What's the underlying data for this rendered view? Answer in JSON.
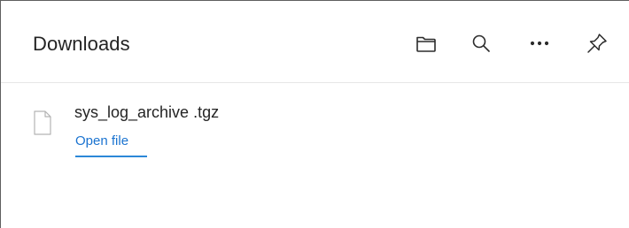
{
  "header": {
    "title": "Downloads",
    "tools": [
      {
        "name": "open-downloads-folder",
        "icon": "folder-icon"
      },
      {
        "name": "search-downloads",
        "icon": "search-icon"
      },
      {
        "name": "more-options",
        "icon": "more-horizontal-icon"
      },
      {
        "name": "pin-downloads",
        "icon": "pin-icon"
      }
    ]
  },
  "downloads": {
    "items": [
      {
        "filename": "sys_log_archive .tgz",
        "icon": "document-icon",
        "action_label": "Open file"
      }
    ]
  },
  "colors": {
    "link": "#1a73d0",
    "text": "#242424",
    "divider": "#e6e6e6"
  }
}
